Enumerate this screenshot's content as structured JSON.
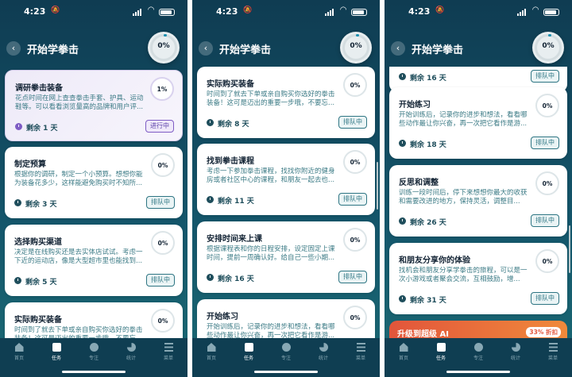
{
  "status": {
    "time": "4:23"
  },
  "header": {
    "title": "开始学拳击",
    "overall_progress": "0%"
  },
  "badges": {
    "in_progress": "进行中",
    "queued": "排队中"
  },
  "screens": [
    {
      "cards": [
        {
          "title": "调研拳击装备",
          "desc": "花点时间在网上查查拳击手套、护具、运动鞋等。可以看看浏览量高的品牌和用户评...",
          "progress": "1%",
          "remaining": "剩余 1 天",
          "status": "进行中",
          "active": true
        },
        {
          "title": "制定预算",
          "desc": "根据你的调研，制定一个小预算。想想你能为装备花多少，这样能避免购买时不知所...",
          "progress": "0%",
          "remaining": "剩余 3 天",
          "status": "排队中"
        },
        {
          "title": "选择购买渠道",
          "desc": "决定是在线购买还是去实体店试试。考虑一下近的运动店，像是大型超市里也能找到...",
          "progress": "0%",
          "remaining": "剩余 5 天",
          "status": "排队中"
        },
        {
          "title": "实际购买装备",
          "desc": "时间到了就去下单或亲自购买你选好的拳击装备！这可是迈出的重要一步哦，不要忘...",
          "progress": "0%",
          "remaining": "",
          "status": ""
        }
      ]
    },
    {
      "cards": [
        {
          "title": "实际购买装备",
          "desc": "时间到了就去下单或亲自购买你选好的拳击装备！这可是迈出的重要一步哦，不要忘...",
          "progress": "0%",
          "remaining": "剩余 8 天",
          "status": "排队中"
        },
        {
          "title": "找到拳击课程",
          "desc": "考虑一下参加拳击课程，找找你附近的健身房或者社区中心的课程，和朋友一起去也...",
          "progress": "0%",
          "remaining": "剩余 11 天",
          "status": "排队中"
        },
        {
          "title": "安排时间来上课",
          "desc": "根据课程表和你的日程安排，设定固定上课时间，提前一周确认好。给自己一些小期...",
          "progress": "0%",
          "remaining": "剩余 16 天",
          "status": "排队中"
        },
        {
          "title": "开始练习",
          "desc": "开始训练后，记录你的进步和想法，看看哪些动作最让你兴奋，再一次把它看作是游...",
          "progress": "0%",
          "remaining": "",
          "status": ""
        }
      ]
    },
    {
      "cards": [
        {
          "title": "",
          "desc": "",
          "progress": "",
          "remaining": "剩余 16 天",
          "status": "排队中"
        },
        {
          "title": "开始练习",
          "desc": "开始训练后，记录你的进步和想法，看看哪些动作最让你兴奋，再一次把它看作是游...",
          "progress": "0%",
          "remaining": "剩余 18 天",
          "status": "排队中"
        },
        {
          "title": "反思和调整",
          "desc": "训练一段时间后，停下来想想你最大的收获和需要改进的地方，保持灵活，调整目...",
          "progress": "0%",
          "remaining": "剩余 26 天",
          "status": "排队中"
        },
        {
          "title": "和朋友分享你的体验",
          "desc": "找机会和朋友分享学拳击的旅程，可以是一次小游戏或者聚会交流，互相鼓励，增...",
          "progress": "0%",
          "remaining": "剩余 31 天",
          "status": "排队中"
        }
      ],
      "promo": {
        "title": "升级到超级 AI",
        "percent": "33% 折扣"
      }
    }
  ],
  "tabs": [
    {
      "label": "首页",
      "icon": "home-icon"
    },
    {
      "label": "任务",
      "icon": "task-icon"
    },
    {
      "label": "专注",
      "icon": "focus-icon"
    },
    {
      "label": "统计",
      "icon": "stats-icon"
    },
    {
      "label": "菜单",
      "icon": "menu-icon"
    }
  ]
}
